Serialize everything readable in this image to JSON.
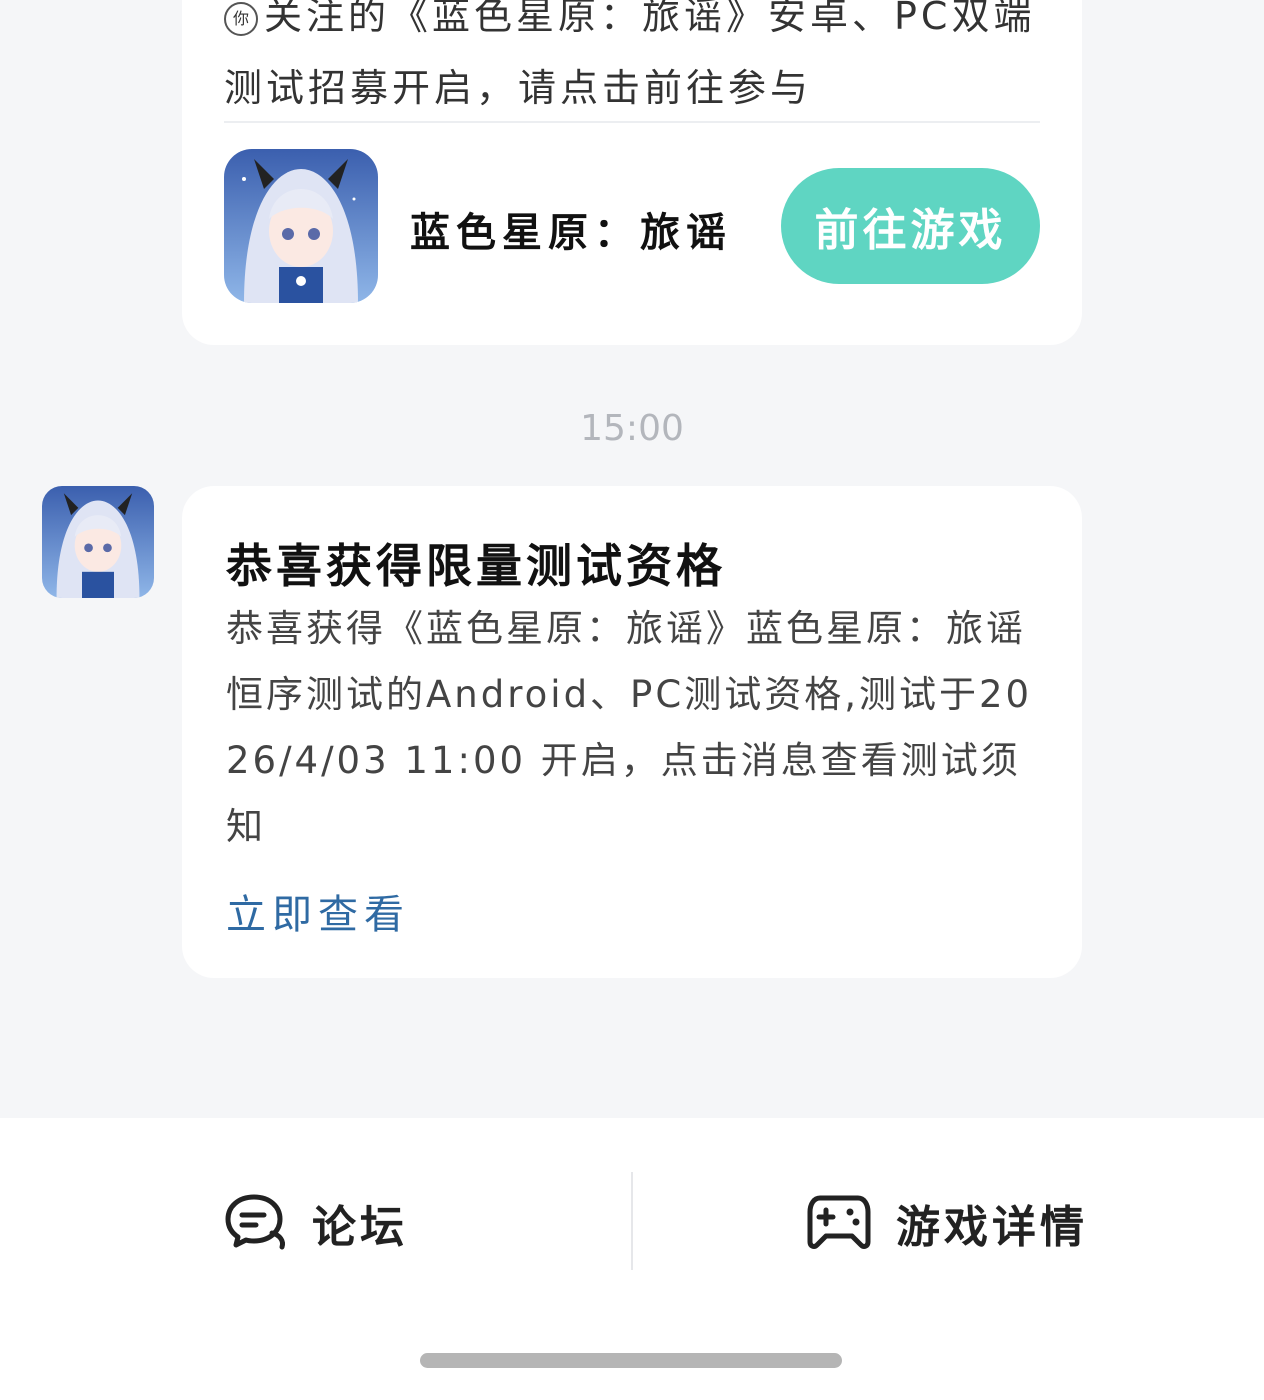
{
  "top_card": {
    "text_line1": "关注的《蓝色星原：旅谣》安卓、PC双端",
    "text_line2": "测试招募开启，请点击前往参与",
    "inline_mark": "你",
    "game_name": "蓝色星原：旅谣",
    "go_button_label": "前往游戏"
  },
  "timestamp": "15:00",
  "message": {
    "title": "恭喜获得限量测试资格",
    "body": "恭喜获得《蓝色星原：旅谣》蓝色星原：旅谣恒序测试的Android、PC测试资格,测试于2026/4/03 11:00 开启，点击消息查看测试须知",
    "link_label": "立即查看"
  },
  "bottom_bar": {
    "forum_label": "论坛",
    "forum_icon": "chat-bubble-icon",
    "details_label": "游戏详情",
    "details_icon": "gamepad-icon"
  },
  "colors": {
    "accent_button": "#5fd5c2",
    "link": "#2f6aa3",
    "background": "#f5f6f8"
  }
}
